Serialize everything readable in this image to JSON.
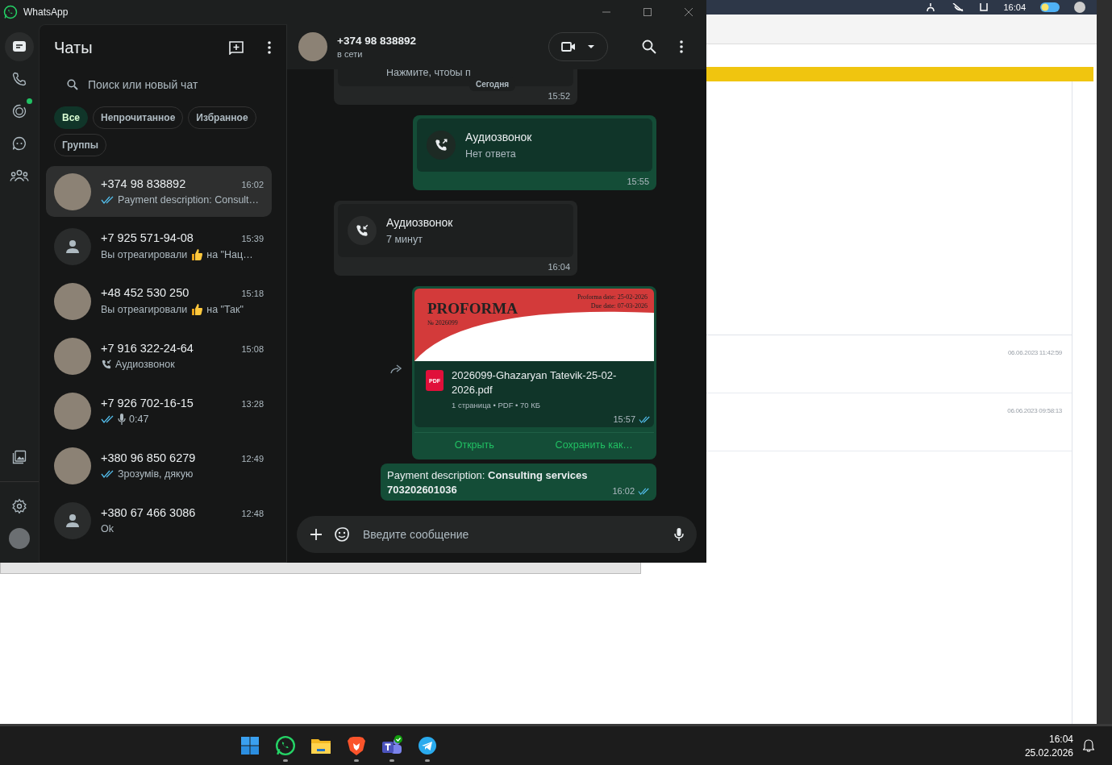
{
  "window": {
    "title": "WhatsApp"
  },
  "nav_rail": {
    "top": [
      {
        "kind": "chats",
        "selected": true,
        "dot": false
      },
      {
        "kind": "calls",
        "selected": false,
        "dot": false
      },
      {
        "kind": "status",
        "selected": false,
        "dot": true
      },
      {
        "kind": "channels",
        "selected": false,
        "dot": false
      },
      {
        "kind": "communities",
        "selected": false,
        "dot": false
      }
    ],
    "bottom": [
      {
        "kind": "media",
        "selected": false,
        "dot": false
      },
      {
        "kind": "settings",
        "selected": false,
        "dot": false
      },
      {
        "kind": "profile",
        "selected": false,
        "dot": false
      }
    ]
  },
  "sidebar": {
    "title": "Чаты",
    "search": {
      "placeholder": "Поиск или новый чат"
    },
    "filters": [
      {
        "label": "Все",
        "selected": true
      },
      {
        "label": "Непрочитанное",
        "selected": false
      },
      {
        "label": "Избранное",
        "selected": false
      },
      {
        "label": "Группы",
        "selected": false
      }
    ],
    "chats": [
      {
        "name": "+374 98 838892",
        "time": "16:02",
        "selected": true,
        "has_photo": true,
        "preview": {
          "kind": "text",
          "read": true,
          "text": "Payment description: Consult…"
        }
      },
      {
        "name": "+7 925 571-94-08",
        "time": "15:39",
        "selected": false,
        "has_photo": false,
        "preview": {
          "kind": "reaction",
          "text": "Вы отреагировали",
          "after": "на \"Нац…"
        }
      },
      {
        "name": "+48 452 530 250",
        "time": "15:18",
        "selected": false,
        "has_photo": true,
        "preview": {
          "kind": "reaction",
          "text": "Вы отреагировали",
          "after": "на \"Так\""
        }
      },
      {
        "name": "+7 916 322-24-64",
        "time": "15:08",
        "selected": false,
        "has_photo": true,
        "preview": {
          "kind": "call",
          "text": "Аудиозвонок"
        }
      },
      {
        "name": "+7 926 702-16-15",
        "time": "13:28",
        "selected": false,
        "has_photo": true,
        "preview": {
          "kind": "voice",
          "read": true,
          "text": "0:47"
        }
      },
      {
        "name": "+380 96 850 6279",
        "time": "12:49",
        "selected": false,
        "has_photo": true,
        "preview": {
          "kind": "text",
          "read": true,
          "text": "Зрозумів, дякую"
        }
      },
      {
        "name": "+380 67 466 3086",
        "time": "12:48",
        "selected": false,
        "has_photo": false,
        "preview": {
          "kind": "text",
          "text": "Ok"
        }
      }
    ]
  },
  "conversation": {
    "name": "+374 98 838892",
    "status": "в сети",
    "date_chip": "Сегодня",
    "messages": [
      {
        "kind": "call",
        "outgoing": false,
        "subtitle": "Нажмите, чтобы п",
        "time": "15:52"
      },
      {
        "kind": "call",
        "outgoing": true,
        "title": "Аудиозвонок",
        "subtitle": "Нет ответа",
        "time": "15:55"
      },
      {
        "kind": "call",
        "outgoing": false,
        "title": "Аудиозвонок",
        "subtitle": "7 минут",
        "time": "16:04"
      },
      {
        "kind": "document",
        "outgoing": true,
        "doc_title": "PROFORMA",
        "doc_number": "№ 2026099",
        "doc_dates": [
          "Proforma date: 25-02-2026",
          "Due date: 07-03-2026"
        ],
        "file_badge": "PDF",
        "filename": "2026099-Ghazaryan Tatevik-25-02-2026.pdf",
        "meta": "1 страница • PDF • 70 КБ",
        "time": "15:57",
        "read": true,
        "actions": [
          "Открыть",
          "Сохранить как…"
        ]
      },
      {
        "kind": "text",
        "outgoing": true,
        "text": "Payment description: **Consulting services 703202601036**",
        "time": "16:02",
        "read": true
      }
    ],
    "composer": {
      "placeholder": "Введите сообщение"
    }
  },
  "browser": {
    "clock": "16:04",
    "rows": [
      {
        "timestamp": "06.06.2023 11:42:59"
      },
      {
        "timestamp": "06.06.2023 09:58:13"
      }
    ]
  },
  "taskbar": {
    "apps": [
      {
        "kind": "start",
        "running": false
      },
      {
        "kind": "whatsapp",
        "running": true
      },
      {
        "kind": "files",
        "running": false
      },
      {
        "kind": "brave",
        "running": true
      },
      {
        "kind": "teams",
        "running": true
      },
      {
        "kind": "telegram",
        "running": true
      }
    ],
    "time": "16:04",
    "date": "25.02.2026"
  }
}
